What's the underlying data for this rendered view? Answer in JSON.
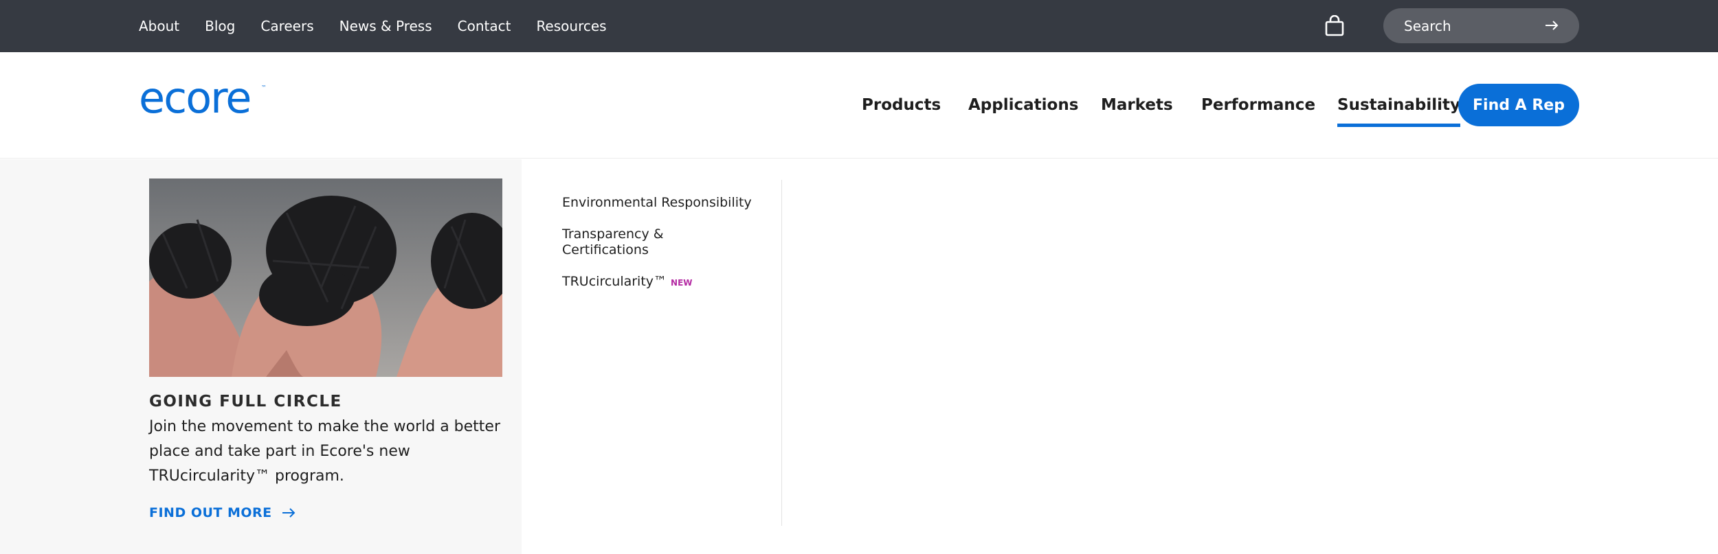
{
  "utility_nav": {
    "links": [
      "About",
      "Blog",
      "Careers",
      "News & Press",
      "Contact",
      "Resources"
    ]
  },
  "search": {
    "placeholder": "Search"
  },
  "header": {
    "logo_text": "ecore",
    "nav": [
      "Products",
      "Applications",
      "Markets",
      "Performance",
      "Sustainability"
    ],
    "active_nav": "Sustainability",
    "cta_label": "Find A Rep"
  },
  "mega_menu": {
    "promo": {
      "title": "GOING FULL CIRCLE",
      "text": "Join the movement to make the world a better place and take part in Ecore's new TRUcircularity™ program.",
      "link_label": "FIND OUT MORE"
    },
    "items": [
      {
        "label": "Environmental Responsibility",
        "badge": ""
      },
      {
        "label": "Transparency & Certifications",
        "badge": ""
      },
      {
        "label": "TRUcircularity™",
        "badge": "NEW"
      }
    ]
  },
  "colors": {
    "topbar": "#363a42",
    "brand_blue": "#0a6fd8",
    "badge_purple": "#b42aa3"
  },
  "icons": [
    "cart-icon",
    "arrow-right-icon"
  ]
}
